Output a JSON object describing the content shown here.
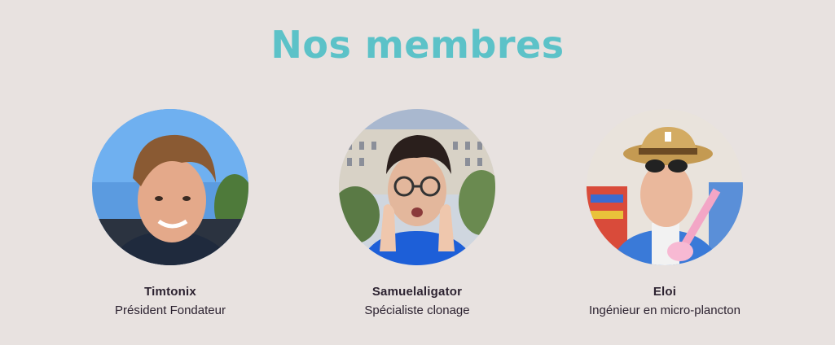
{
  "section": {
    "title": "Nos membres"
  },
  "members": [
    {
      "name": "Timtonix",
      "role": "Président Fondateur",
      "photo_icon": "portrait-photo"
    },
    {
      "name": "Samuelaligator",
      "role": "Spécialiste clonage",
      "photo_icon": "portrait-photo"
    },
    {
      "name": "Eloi",
      "role": "Ingénieur en micro-plancton",
      "photo_icon": "portrait-photo"
    }
  ],
  "colors": {
    "background": "#e8e2e0",
    "title": "#5cc2c8",
    "text": "#2c2230"
  }
}
